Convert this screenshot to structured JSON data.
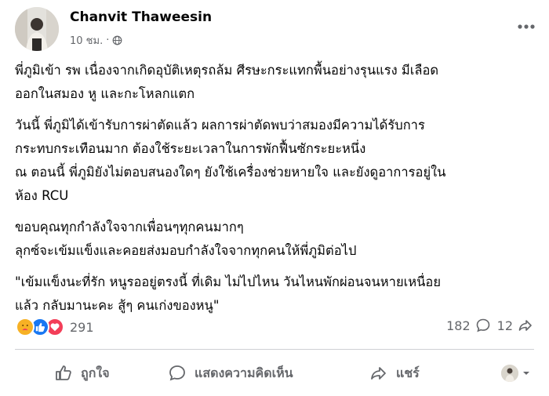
{
  "post": {
    "author": "Chanvit Thaweesin",
    "timestamp": "10 ชม.",
    "separator": "·",
    "paragraphs": [
      [
        "พี่ภูมิเข้า รพ เนื่องจากเกิดอุบัติเหตุรถล้ม ศีรษะกระแทกพื้นอย่างรุนแรง มีเลือด",
        "ออกในสมอง หู และกะโหลกแตก"
      ],
      [
        "วันนี้ พี่ภูมิได้เข้ารับการผ่าตัดแล้ว ผลการผ่าตัดพบว่าสมองมีความได้รับการ",
        "กระทบกระเทือนมาก ต้องใช้ระยะเวลาในการพักฟื้นซักระยะหนึ่ง",
        "ณ ตอนนี้ พี่ภูมิยังไม่ตอบสนองใดๆ ยังใช้เครื่องช่วยหายใจ และยังดูอาการอยู่ใน",
        "ห้อง RCU"
      ],
      [
        "ขอบคุณทุกกำลังใจจากเพื่อนๆทุกคนมากๆ",
        "ลุกซ์จะเข้มแข็งและคอยส่งมอบกำลังใจจากทุกคนให้พี่ภูมิต่อไป"
      ],
      [
        "\"เข้มแข็งนะที่รัก หนูรออยู่ตรงนี้ ที่เดิม ไม่ไปไหน วันไหนพักผ่อนจนหายเหนื่อย",
        "แล้ว กลับมานะคะ สู้ๆ คนเก่งของหนู\""
      ]
    ]
  },
  "engagement": {
    "reaction_count": "291",
    "comment_count": "182",
    "share_count": "12",
    "reactions": [
      "care",
      "like",
      "love"
    ]
  },
  "actions": {
    "like_label": "ถูกใจ",
    "comment_label": "แสดงความคิดเห็น",
    "share_label": "แชร์"
  },
  "colors": {
    "text": "#050505",
    "secondary": "#65676b",
    "like_blue": "#1877f2",
    "love_red": "#f33e58",
    "care_yellow": "#f7b125",
    "divider": "#ced0d4"
  }
}
